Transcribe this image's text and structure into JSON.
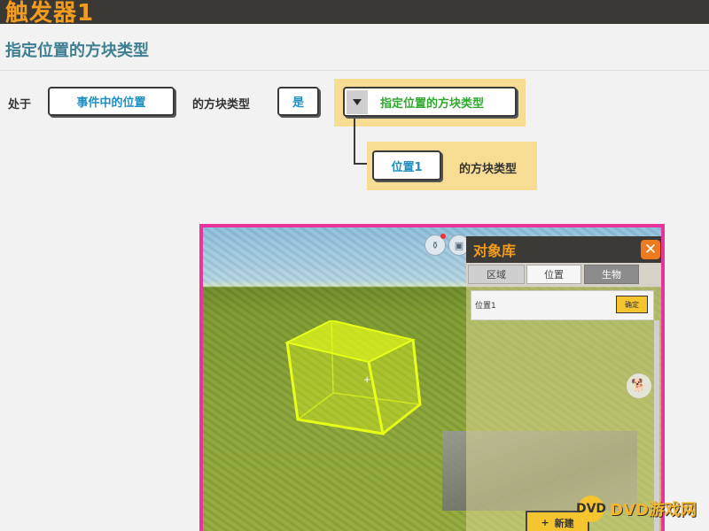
{
  "window": {
    "title": "触发器1"
  },
  "subtitle": "指定位置的方块类型",
  "condition": {
    "prefix": "处于",
    "event_position": "事件中的位置",
    "block_type_label": "的方块类型",
    "operator": "是",
    "value_selector": "指定位置的方块类型"
  },
  "sub_condition": {
    "position": "位置1",
    "block_type_label": "的方块类型"
  },
  "object_library": {
    "title": "对象库",
    "close_glyph": "✕",
    "tabs": [
      {
        "label": "区域"
      },
      {
        "label": "位置"
      },
      {
        "label": "生物"
      }
    ],
    "items": [
      {
        "name": "位置1",
        "action": "确定"
      }
    ],
    "new_button": "新建",
    "new_glyph": "+"
  },
  "icons": [
    "dropdown-icon",
    "close-icon",
    "plus-icon",
    "pet-icon",
    "bag-icon",
    "map-icon"
  ],
  "colors": {
    "title": "#f29c1f",
    "subtitle": "#3e7f93",
    "chip_text": "#1f8fc1",
    "selector_text": "#2faa2f",
    "panel_bg": "#f7dc93",
    "shot_border": "#e8349b",
    "cube": "#e8ff1a",
    "button_yellow": "#f4c52e"
  },
  "watermark": {
    "text": "DVD游戏网",
    "logo": "DVD"
  }
}
